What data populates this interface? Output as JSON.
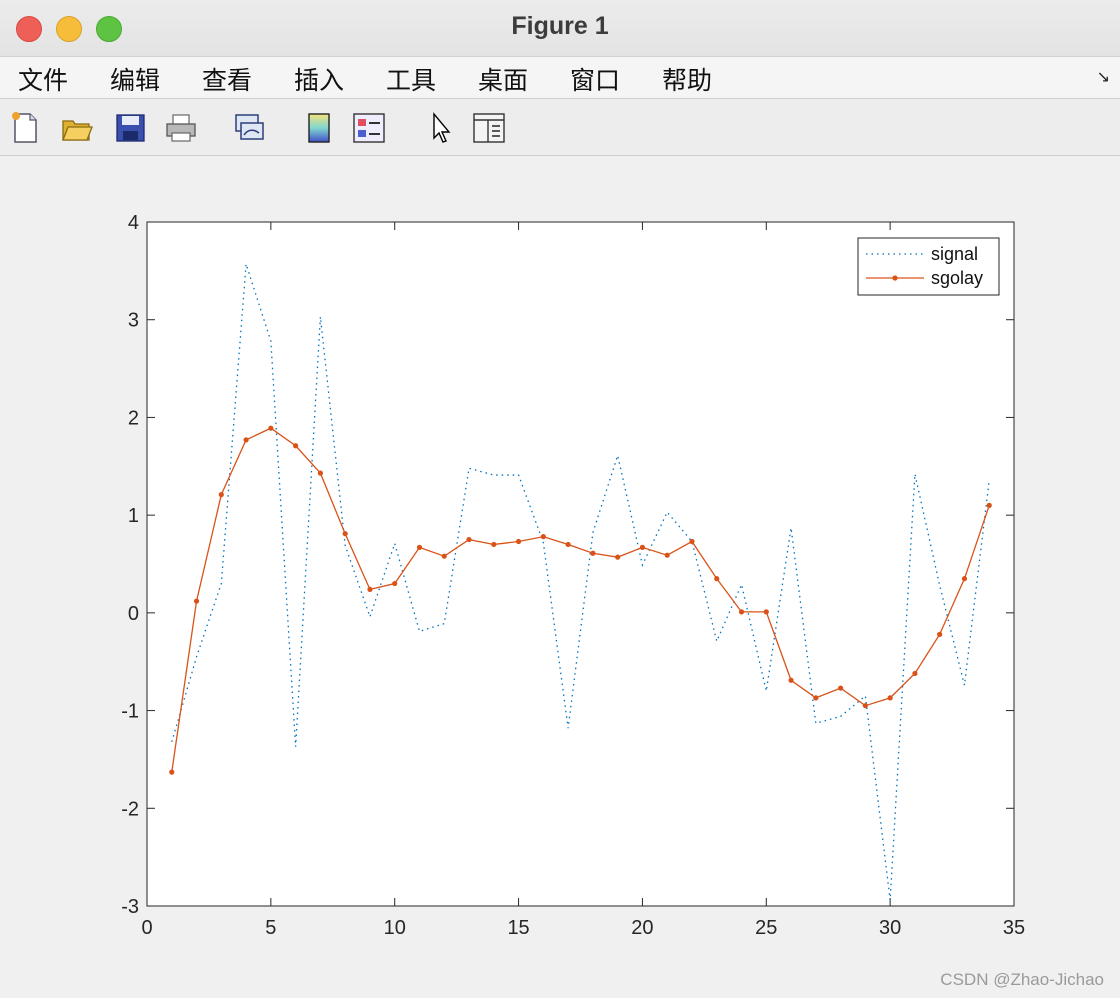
{
  "window": {
    "title": "Figure 1"
  },
  "menu": {
    "items": [
      "文件",
      "编辑",
      "查看",
      "插入",
      "工具",
      "桌面",
      "窗口",
      "帮助"
    ],
    "corner_glyph": "↘"
  },
  "toolbar": {
    "tools": [
      "new-figure-icon",
      "open-file-icon",
      "save-icon",
      "print-icon",
      "link-plot-icon",
      "colorbar-icon",
      "legend-icon",
      "pointer-icon",
      "property-editor-icon"
    ]
  },
  "colors": {
    "signal": "#0072bd",
    "sgolay": "#d95319",
    "background": "#f0f0f0"
  },
  "watermark": "CSDN @Zhao-Jichao",
  "chart_data": {
    "type": "line",
    "xlim": [
      0,
      35
    ],
    "ylim": [
      -3,
      4
    ],
    "xticks": [
      0,
      5,
      10,
      15,
      20,
      25,
      30,
      35
    ],
    "yticks": [
      -3,
      -2,
      -1,
      0,
      1,
      2,
      3,
      4
    ],
    "legend_position": "top-right",
    "grid": false,
    "x": [
      1,
      2,
      3,
      4,
      5,
      6,
      7,
      8,
      9,
      10,
      11,
      12,
      13,
      14,
      15,
      16,
      17,
      18,
      19,
      20,
      21,
      22,
      23,
      24,
      25,
      26,
      27,
      28,
      29,
      30,
      31,
      32,
      33,
      34
    ],
    "series": [
      {
        "name": "signal",
        "style": "dotted",
        "values": [
          -1.32,
          -0.45,
          0.3,
          3.57,
          2.78,
          -1.37,
          3.03,
          0.69,
          -0.04,
          0.71,
          -0.19,
          -0.11,
          1.48,
          1.41,
          1.41,
          0.72,
          -1.18,
          0.82,
          1.61,
          0.49,
          1.03,
          0.73,
          -0.29,
          0.29,
          -0.8,
          0.87,
          -1.13,
          -1.06,
          -0.85,
          -2.94,
          1.42,
          0.28,
          -0.74,
          1.36
        ]
      },
      {
        "name": "sgolay",
        "style": "solid-dot",
        "values": [
          -1.63,
          0.12,
          1.21,
          1.77,
          1.89,
          1.71,
          1.43,
          0.81,
          0.24,
          0.3,
          0.67,
          0.58,
          0.75,
          0.7,
          0.73,
          0.78,
          0.7,
          0.61,
          0.57,
          0.67,
          0.59,
          0.73,
          0.35,
          0.01,
          0.01,
          -0.69,
          -0.87,
          -0.77,
          -0.95,
          -0.87,
          -0.62,
          -0.22,
          0.35,
          1.1
        ]
      }
    ]
  }
}
